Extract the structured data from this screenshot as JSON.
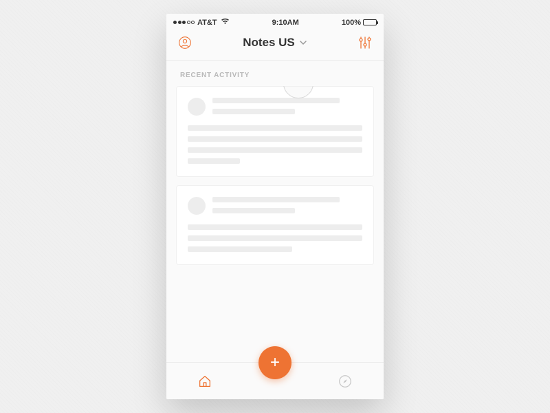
{
  "status_bar": {
    "carrier": "AT&T",
    "time": "9:10AM",
    "battery": "100%"
  },
  "header": {
    "title": "Notes US"
  },
  "section": {
    "label": "RECENT ACTIVITY"
  },
  "fab": {
    "label": "+"
  },
  "colors": {
    "accent": "#ee7333"
  }
}
